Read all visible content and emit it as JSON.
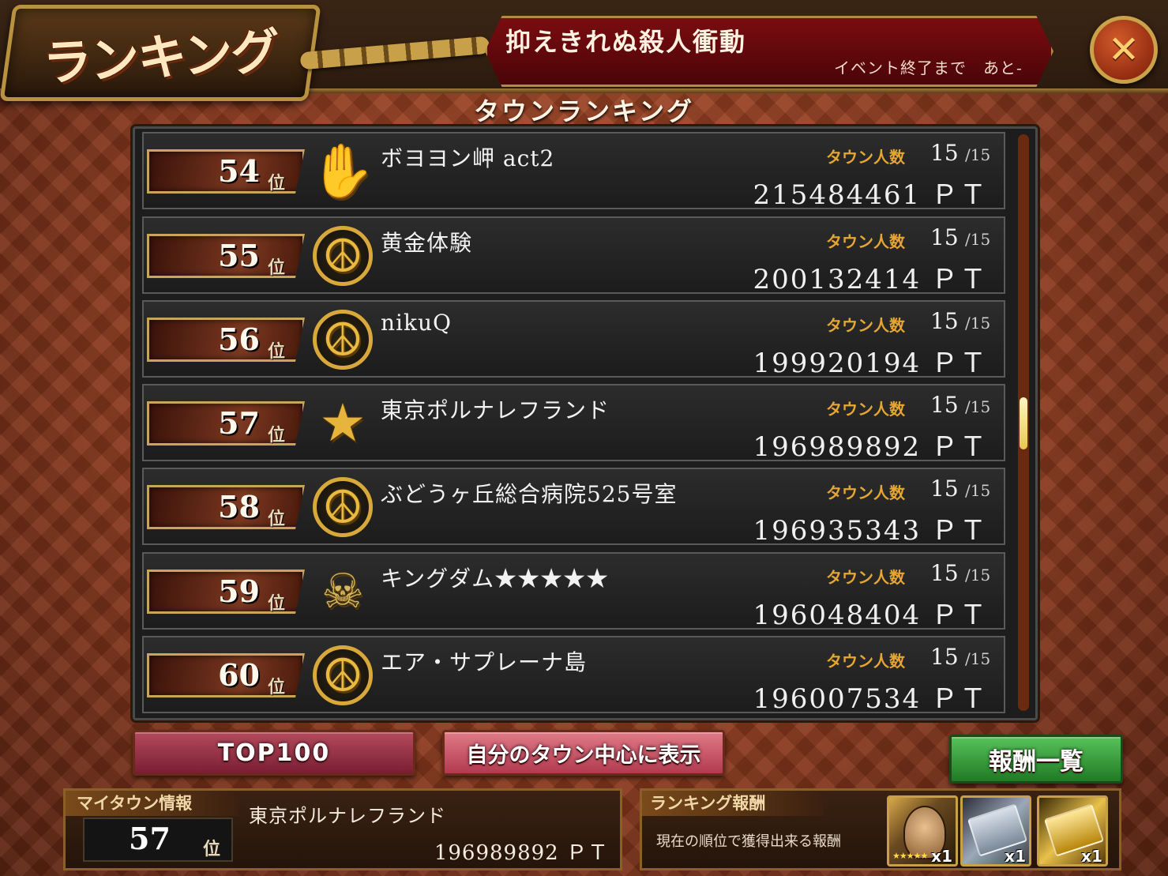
{
  "header": {
    "logo_text": "ランキング",
    "event_title": "抑えきれぬ殺人衝動",
    "event_remaining": "イベント終了まで　あと-",
    "close_icon": "✕"
  },
  "section_title": "タウンランキング",
  "rows": [
    {
      "rank": "54",
      "rank_suffix": "位",
      "emblem": "✋",
      "emblem_name": "hand-icon",
      "name": "ボヨヨン岬 act2",
      "members_label": "タウン人数",
      "members": "15",
      "members_max": "/15",
      "points": "215484461 ＰＴ"
    },
    {
      "rank": "55",
      "rank_suffix": "位",
      "emblem": "☮",
      "emblem_name": "peace-icon",
      "name": "黄金体験",
      "members_label": "タウン人数",
      "members": "15",
      "members_max": "/15",
      "points": "200132414 ＰＴ"
    },
    {
      "rank": "56",
      "rank_suffix": "位",
      "emblem": "☮",
      "emblem_name": "peace-icon",
      "name": "nikuQ",
      "members_label": "タウン人数",
      "members": "15",
      "members_max": "/15",
      "points": "199920194 ＰＴ"
    },
    {
      "rank": "57",
      "rank_suffix": "位",
      "emblem": "★",
      "emblem_name": "star-icon",
      "name": "東京ポルナレフランド",
      "members_label": "タウン人数",
      "members": "15",
      "members_max": "/15",
      "points": "196989892 ＰＴ"
    },
    {
      "rank": "58",
      "rank_suffix": "位",
      "emblem": "☮",
      "emblem_name": "peace-icon",
      "name": "ぶどうヶ丘総合病院525号室",
      "members_label": "タウン人数",
      "members": "15",
      "members_max": "/15",
      "points": "196935343 ＰＴ"
    },
    {
      "rank": "59",
      "rank_suffix": "位",
      "emblem": "☠",
      "emblem_name": "skull-icon",
      "name": "キングダム★★★★★",
      "members_label": "タウン人数",
      "members": "15",
      "members_max": "/15",
      "points": "196048404 ＰＴ"
    },
    {
      "rank": "60",
      "rank_suffix": "位",
      "emblem": "☮",
      "emblem_name": "peace-icon",
      "name": "エア・サプレーナ島",
      "members_label": "タウン人数",
      "members": "15",
      "members_max": "/15",
      "points": "196007534 ＰＴ"
    }
  ],
  "buttons": {
    "top100": "TOP100",
    "center_on_my_town": "自分のタウン中心に表示",
    "reward_list": "報酬一覧"
  },
  "my_town": {
    "header": "マイタウン情報",
    "rank": "57",
    "rank_suffix": "位",
    "name": "東京ポルナレフランド",
    "points": "196989892 ＰＴ"
  },
  "ranking_reward": {
    "header": "ランキング報酬",
    "description": "現在の順位で獲得出来る報酬",
    "items": [
      {
        "name": "character-card",
        "qty": "x1"
      },
      {
        "name": "silver-ticket",
        "qty": "x1"
      },
      {
        "name": "gold-ticket",
        "qty": "x1"
      }
    ]
  },
  "colors": {
    "background": "#8c3a1e",
    "members_label": "#e6a632",
    "event_banner": "#7a0c10",
    "reward_button": "#3aa83e",
    "top100_button": "#9a3048"
  }
}
